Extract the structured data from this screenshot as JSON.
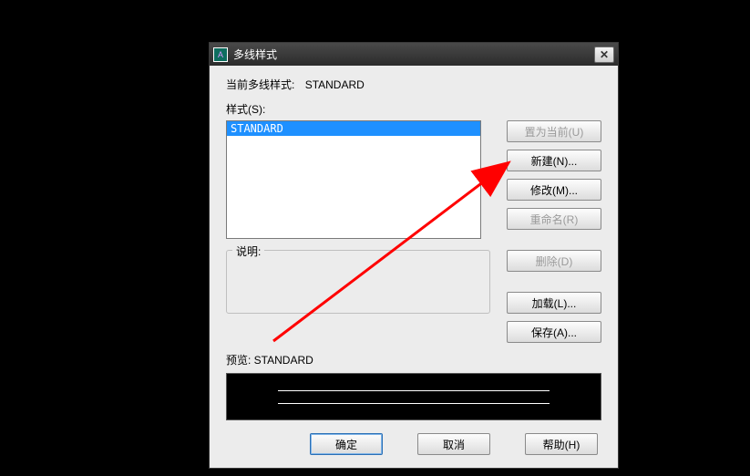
{
  "titlebar": {
    "title": "多线样式",
    "close": "✕"
  },
  "current": {
    "label": "当前多线样式:",
    "value": "STANDARD"
  },
  "stylesLabel": "样式(S):",
  "list": {
    "items": [
      "STANDARD"
    ],
    "selected": 0
  },
  "buttons": {
    "setCurrent": "置为当前(U)",
    "new": "新建(N)...",
    "modify": "修改(M)...",
    "rename": "重命名(R)",
    "delete": "删除(D)",
    "load": "加载(L)...",
    "save": "保存(A)..."
  },
  "descLabel": "说明:",
  "descValue": "",
  "previewLabel": "预览: STANDARD",
  "bottom": {
    "ok": "确定",
    "cancel": "取消",
    "help": "帮助(H)"
  }
}
